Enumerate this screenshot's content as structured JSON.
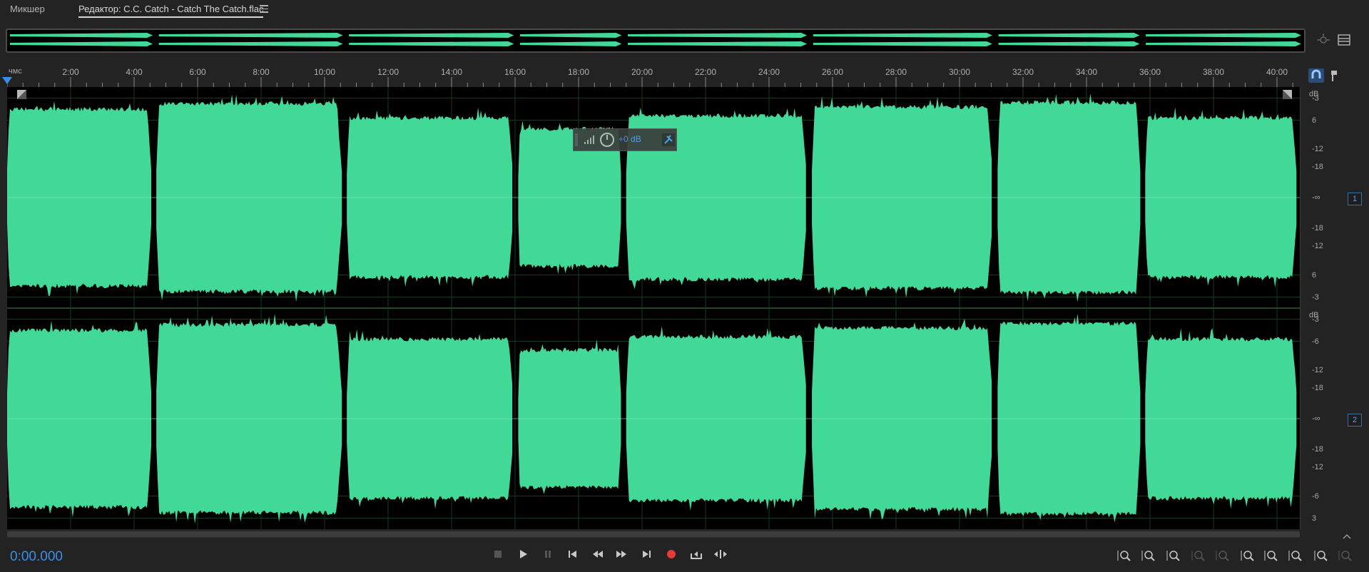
{
  "tabs": {
    "mixer_label": "Микшер",
    "editor_label": "Редактор: C.C. Catch - Catch The Catch.flac"
  },
  "ruler": {
    "unit": "чмс",
    "ticks": [
      "2:00",
      "4:00",
      "6:00",
      "8:00",
      "10:00",
      "12:00",
      "14:00",
      "16:00",
      "18:00",
      "20:00",
      "22:00",
      "24:00",
      "26:00",
      "28:00",
      "30:00",
      "32:00",
      "34:00",
      "36:00",
      "38:00",
      "40:00"
    ]
  },
  "amplitude_scale": {
    "unit": "dB",
    "labels": [
      "-3",
      "6",
      "-12",
      "-18",
      "-∞",
      "-18",
      "-12",
      "6",
      "-3"
    ],
    "labels_ch2": [
      "-3",
      "-6",
      "-12",
      "-18",
      "-∞",
      "-18",
      "-12",
      "-6",
      "3"
    ]
  },
  "channels": [
    "1",
    "2"
  ],
  "hud": {
    "gain": "+0 dB"
  },
  "transport": {
    "timecode": "0:00.000",
    "buttons": [
      "stop-icon",
      "play-icon",
      "pause-icon",
      "skip-start-icon",
      "rewind-icon",
      "fast-forward-icon",
      "skip-end-icon",
      "record-icon",
      "loop-icon",
      "skip-selection-icon"
    ]
  },
  "zoom_buttons": [
    "zoom-in-amplitude-icon",
    "zoom-out-amplitude-icon",
    "zoom-reset-amplitude-icon",
    "zoom-in-time-disabled-icon",
    "zoom-selection-disabled-icon",
    "zoom-in-left-icon",
    "zoom-in-right-icon",
    "zoom-out-full-icon",
    "zoom-time-icon",
    "zoom-disabled-icon"
  ],
  "colors": {
    "waveform": "#42d898",
    "accent": "#3c8fe6",
    "record": "#e83a3a",
    "background": "#000000"
  },
  "songs": [
    {
      "start": 0.0,
      "end": 4.55,
      "loud": 0.78
    },
    {
      "start": 4.7,
      "end": 10.55,
      "loud": 0.83
    },
    {
      "start": 10.7,
      "end": 15.95,
      "loud": 0.7
    },
    {
      "start": 16.1,
      "end": 19.35,
      "loud": 0.6
    },
    {
      "start": 19.5,
      "end": 25.2,
      "loud": 0.72
    },
    {
      "start": 25.35,
      "end": 31.05,
      "loud": 0.8
    },
    {
      "start": 31.2,
      "end": 35.7,
      "loud": 0.84
    },
    {
      "start": 35.85,
      "end": 40.8,
      "loud": 0.7
    }
  ]
}
